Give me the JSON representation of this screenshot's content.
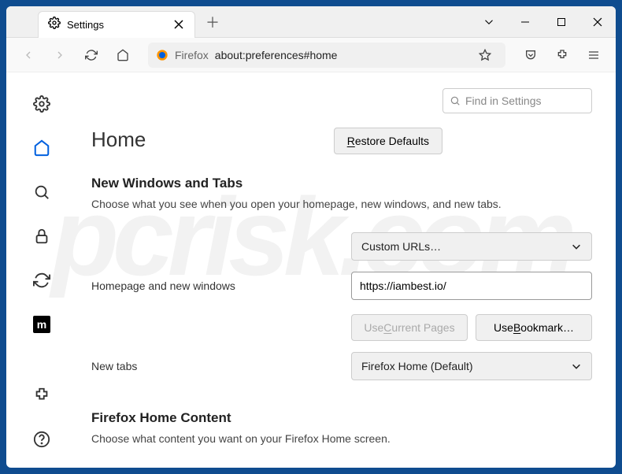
{
  "tab": {
    "title": "Settings"
  },
  "toolbar": {
    "urlbar_prefix": "Firefox",
    "urlbar_value": "about:preferences#home"
  },
  "search": {
    "placeholder": "Find in Settings"
  },
  "page": {
    "title": "Home",
    "restore_btn": "Restore Defaults",
    "section1": {
      "heading": "New Windows and Tabs",
      "desc": "Choose what you see when you open your homepage, new windows, and new tabs.",
      "homepage_label": "Homepage and new windows",
      "homepage_select": "Custom URLs…",
      "homepage_url": "https://iambest.io/",
      "use_current": "Use Current Pages",
      "use_bookmark": "Use Bookmark…",
      "newtabs_label": "New tabs",
      "newtabs_select": "Firefox Home (Default)"
    },
    "section2": {
      "heading": "Firefox Home Content",
      "desc": "Choose what content you want on your Firefox Home screen."
    }
  },
  "moz_icon_text": "m"
}
